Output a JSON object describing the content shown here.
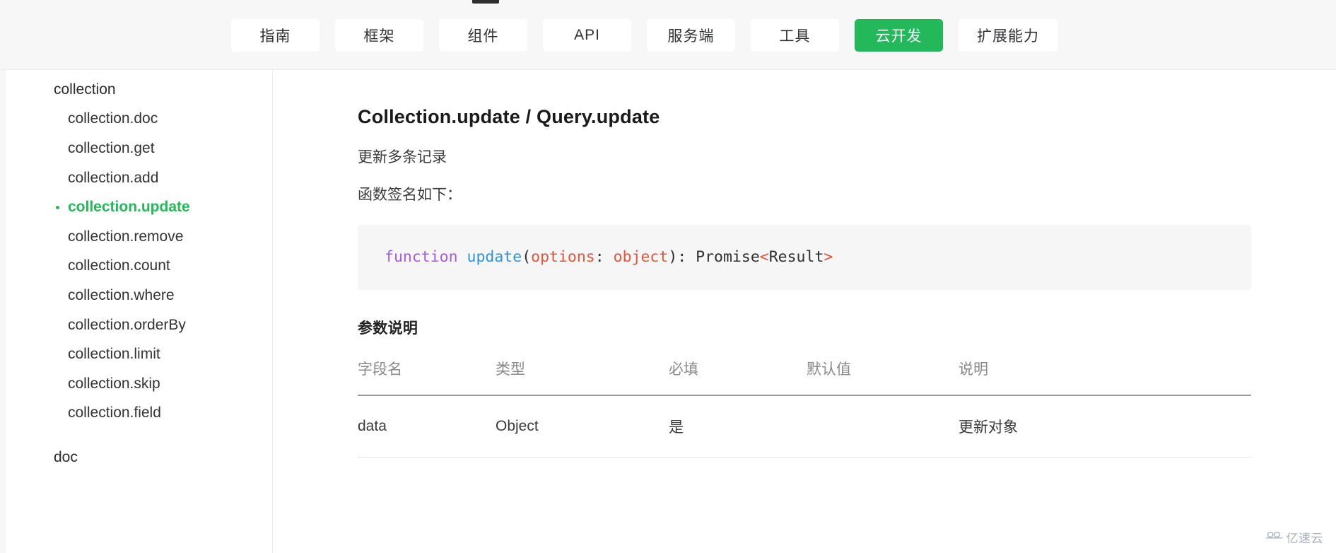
{
  "topnav": {
    "tabs": [
      {
        "label": "指南",
        "active": false
      },
      {
        "label": "框架",
        "active": false
      },
      {
        "label": "组件",
        "active": false
      },
      {
        "label": "API",
        "active": false
      },
      {
        "label": "服务端",
        "active": false
      },
      {
        "label": "工具",
        "active": false
      },
      {
        "label": "云开发",
        "active": true
      },
      {
        "label": "扩展能力",
        "active": false
      }
    ],
    "active_color": "#23b85a",
    "background": "#f7f7f7"
  },
  "sidebar": {
    "groups": [
      {
        "label": "collection",
        "items": [
          {
            "label": "collection.doc",
            "active": false
          },
          {
            "label": "collection.get",
            "active": false
          },
          {
            "label": "collection.add",
            "active": false
          },
          {
            "label": "collection.update",
            "active": true
          },
          {
            "label": "collection.remove",
            "active": false
          },
          {
            "label": "collection.count",
            "active": false
          },
          {
            "label": "collection.where",
            "active": false
          },
          {
            "label": "collection.orderBy",
            "active": false
          },
          {
            "label": "collection.limit",
            "active": false
          },
          {
            "label": "collection.skip",
            "active": false
          },
          {
            "label": "collection.field",
            "active": false
          }
        ]
      },
      {
        "label": "doc",
        "items": []
      }
    ],
    "active_color": "#23b85a"
  },
  "main": {
    "title": "Collection.update / Query.update",
    "description": "更新多条记录",
    "signature_intro": "函数签名如下：",
    "code": {
      "keyword": "function",
      "fn_name": "update",
      "open_paren": "(",
      "param_name": "options",
      "colon_space": ": ",
      "param_type": "object",
      "close_paren": ")",
      "return_colon": ": ",
      "return_type": "Promise",
      "angle_open": "<",
      "generic": "Result",
      "angle_close": ">",
      "full": "function update(options: object): Promise<Result>"
    },
    "params_section_title": "参数说明",
    "table": {
      "headers": [
        "字段名",
        "类型",
        "必填",
        "默认值",
        "说明"
      ],
      "rows": [
        [
          "data",
          "Object",
          "是",
          "",
          "更新对象"
        ]
      ]
    }
  },
  "watermark": {
    "text": "亿速云",
    "icon": "cloud-icon"
  }
}
